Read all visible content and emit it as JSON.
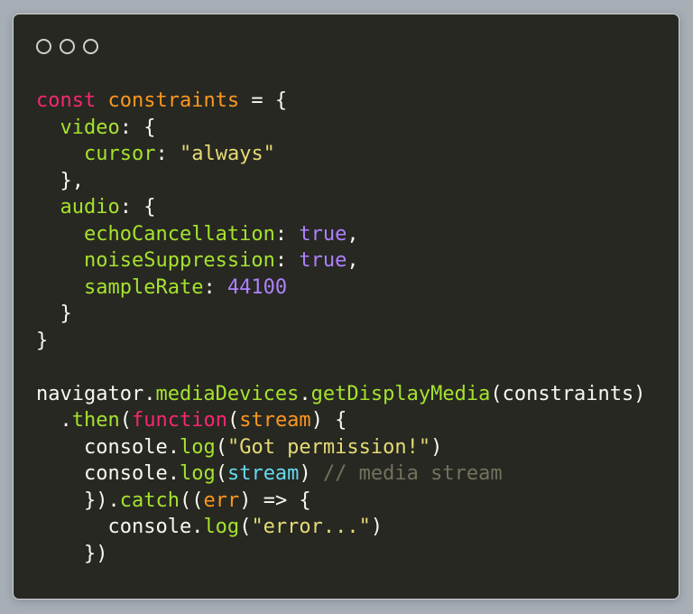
{
  "window": {
    "controls": [
      "close",
      "minimize",
      "maximize"
    ]
  },
  "code": {
    "lines": [
      [
        {
          "t": "const",
          "c": "kw"
        },
        {
          "t": " ",
          "c": "plain"
        },
        {
          "t": "constraints",
          "c": "var"
        },
        {
          "t": " = {",
          "c": "plain"
        }
      ],
      [
        {
          "t": "  ",
          "c": "plain"
        },
        {
          "t": "video",
          "c": "prop"
        },
        {
          "t": ": {",
          "c": "plain"
        }
      ],
      [
        {
          "t": "    ",
          "c": "plain"
        },
        {
          "t": "cursor",
          "c": "prop"
        },
        {
          "t": ": ",
          "c": "plain"
        },
        {
          "t": "\"always\"",
          "c": "str"
        }
      ],
      [
        {
          "t": "  },",
          "c": "plain"
        }
      ],
      [
        {
          "t": "  ",
          "c": "plain"
        },
        {
          "t": "audio",
          "c": "prop"
        },
        {
          "t": ": {",
          "c": "plain"
        }
      ],
      [
        {
          "t": "    ",
          "c": "plain"
        },
        {
          "t": "echoCancellation",
          "c": "prop"
        },
        {
          "t": ": ",
          "c": "plain"
        },
        {
          "t": "true",
          "c": "bool"
        },
        {
          "t": ",",
          "c": "plain"
        }
      ],
      [
        {
          "t": "    ",
          "c": "plain"
        },
        {
          "t": "noiseSuppression",
          "c": "prop"
        },
        {
          "t": ": ",
          "c": "plain"
        },
        {
          "t": "true",
          "c": "bool"
        },
        {
          "t": ",",
          "c": "plain"
        }
      ],
      [
        {
          "t": "    ",
          "c": "plain"
        },
        {
          "t": "sampleRate",
          "c": "prop"
        },
        {
          "t": ": ",
          "c": "plain"
        },
        {
          "t": "44100",
          "c": "num"
        }
      ],
      [
        {
          "t": "  }",
          "c": "plain"
        }
      ],
      [
        {
          "t": "}",
          "c": "plain"
        }
      ],
      [
        {
          "t": "",
          "c": "plain"
        }
      ],
      [
        {
          "t": "navigator.",
          "c": "plain"
        },
        {
          "t": "mediaDevices",
          "c": "prop"
        },
        {
          "t": ".",
          "c": "plain"
        },
        {
          "t": "getDisplayMedia",
          "c": "prop"
        },
        {
          "t": "(constraints)",
          "c": "plain"
        }
      ],
      [
        {
          "t": "  .",
          "c": "plain"
        },
        {
          "t": "then",
          "c": "prop"
        },
        {
          "t": "(",
          "c": "plain"
        },
        {
          "t": "function",
          "c": "kw"
        },
        {
          "t": "(",
          "c": "plain"
        },
        {
          "t": "stream",
          "c": "var"
        },
        {
          "t": ") {",
          "c": "plain"
        }
      ],
      [
        {
          "t": "    console.",
          "c": "plain"
        },
        {
          "t": "log",
          "c": "prop"
        },
        {
          "t": "(",
          "c": "plain"
        },
        {
          "t": "\"Got permission!\"",
          "c": "str"
        },
        {
          "t": ")",
          "c": "plain"
        }
      ],
      [
        {
          "t": "    console.",
          "c": "plain"
        },
        {
          "t": "log",
          "c": "prop"
        },
        {
          "t": "(",
          "c": "plain"
        },
        {
          "t": "stream",
          "c": "param"
        },
        {
          "t": ") ",
          "c": "plain"
        },
        {
          "t": "// media stream",
          "c": "cmt"
        }
      ],
      [
        {
          "t": "    }).",
          "c": "plain"
        },
        {
          "t": "catch",
          "c": "prop"
        },
        {
          "t": "((",
          "c": "plain"
        },
        {
          "t": "err",
          "c": "var"
        },
        {
          "t": ") => {",
          "c": "plain"
        }
      ],
      [
        {
          "t": "      console.",
          "c": "plain"
        },
        {
          "t": "log",
          "c": "prop"
        },
        {
          "t": "(",
          "c": "plain"
        },
        {
          "t": "\"error...\"",
          "c": "str"
        },
        {
          "t": ")",
          "c": "plain"
        }
      ],
      [
        {
          "t": "    })",
          "c": "plain"
        }
      ]
    ]
  }
}
